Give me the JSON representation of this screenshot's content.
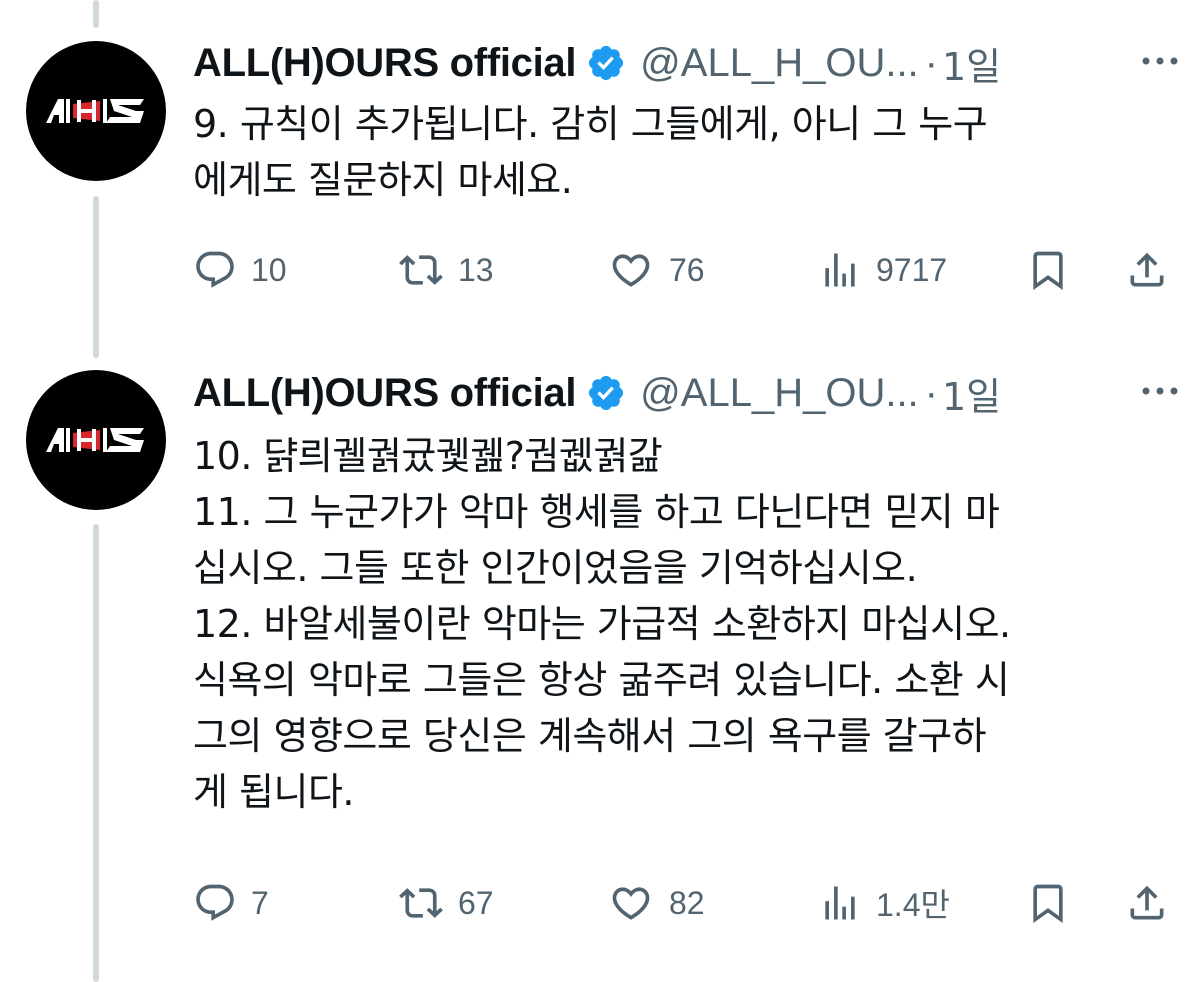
{
  "tweets": [
    {
      "author": {
        "name": "ALL(H)OURS official",
        "handle": "@ALL_H_OU...",
        "verified": true,
        "avatar_text": "AHS"
      },
      "separator": "·",
      "time": "1일",
      "lines": [
        "9. 규칙이 추가됩니다. 감히 그들에게, 아니 그 누구",
        "에게도 질문하지 마세요."
      ],
      "stats": {
        "replies": "10",
        "retweets": "13",
        "likes": "76",
        "views": "9717"
      }
    },
    {
      "author": {
        "name": "ALL(H)OURS official",
        "handle": "@ALL_H_OU...",
        "verified": true,
        "avatar_text": "AHS"
      },
      "separator": "·",
      "time": "1일",
      "lines": [
        "10. 댥릐궬궑귰궻궲?궘궶궑갎",
        "11. 그 누군가가 악마 행세를 하고 다닌다면 믿지 마",
        "십시오. 그들 또한 인간이었음을 기억하십시오.",
        "12. 바알세불이란 악마는 가급적 소환하지 마십시오.",
        "식욕의 악마로 그들은 항상 굶주려 있습니다. 소환 시",
        "그의 영향으로 당신은 계속해서 그의 욕구를 갈구하",
        "게 됩니다."
      ],
      "stats": {
        "replies": "7",
        "retweets": "67",
        "likes": "82",
        "views": "1.4만"
      }
    }
  ],
  "colors": {
    "text": "#0f1419",
    "secondary": "#536471",
    "verified": "#1d9bf0",
    "thread_line": "#cfd9de",
    "avatar_bg": "#000000",
    "logo_red": "#d7262e"
  },
  "icons": [
    "reply-icon",
    "retweet-icon",
    "like-icon",
    "views-icon",
    "bookmark-icon",
    "share-icon",
    "more-icon",
    "verified-badge-icon"
  ]
}
